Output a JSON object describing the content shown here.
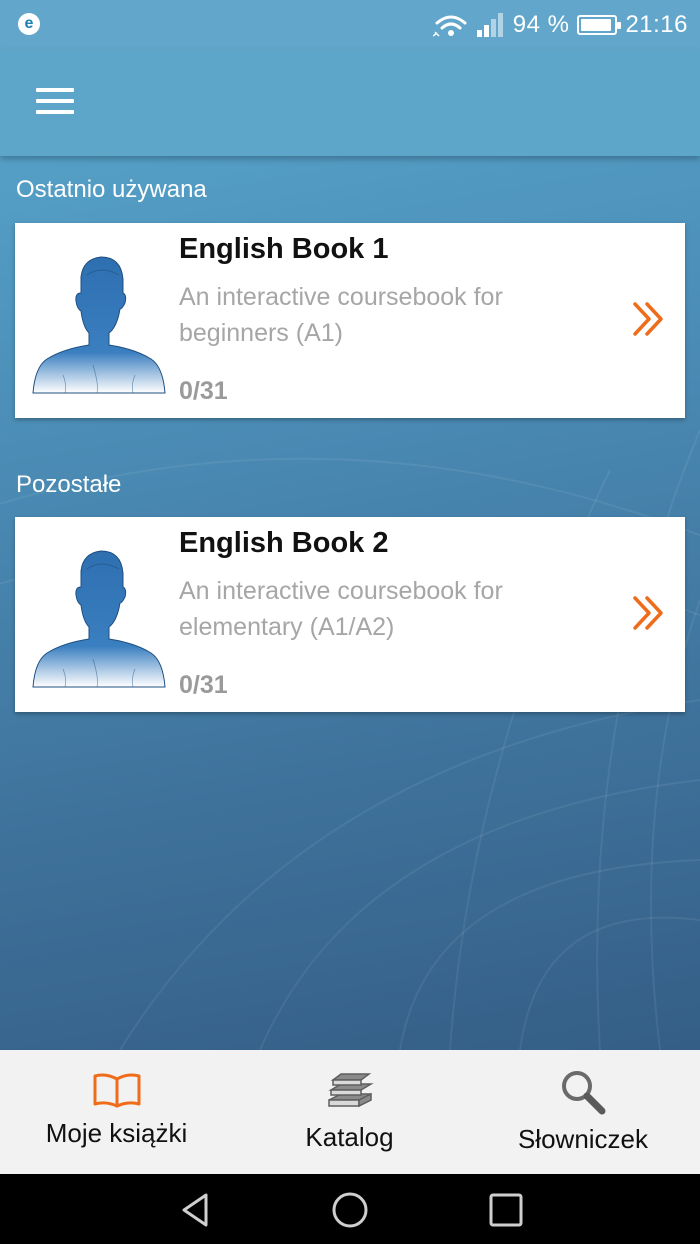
{
  "status_bar": {
    "battery_percent": "94 %",
    "battery_level": 0.94,
    "time": "21:16",
    "notification_icon": "eset-icon"
  },
  "app_bar": {
    "menu_icon": "hamburger-menu-icon"
  },
  "sections": [
    {
      "label": "Ostatnio używana",
      "books": [
        {
          "title": "English Book 1",
          "description": "An interactive coursebook for beginners (A1)",
          "progress": "0/31",
          "arrow_icon": "double-chevron-right-icon"
        }
      ]
    },
    {
      "label": "Pozostałe",
      "books": [
        {
          "title": "English Book 2",
          "description": "An interactive coursebook for elementary (A1/A2)",
          "progress": "0/31",
          "arrow_icon": "double-chevron-right-icon"
        }
      ]
    }
  ],
  "bottom_nav": {
    "items": [
      {
        "label": "Moje książki",
        "icon": "open-book-icon",
        "active": true
      },
      {
        "label": "Katalog",
        "icon": "book-stack-icon",
        "active": false
      },
      {
        "label": "Słowniczek",
        "icon": "magnifier-icon",
        "active": false
      }
    ]
  },
  "colors": {
    "accent": "#ef6c1a",
    "app_bar": "#5ea5ca",
    "card_title": "#111111",
    "card_description": "#a6a6a6"
  }
}
